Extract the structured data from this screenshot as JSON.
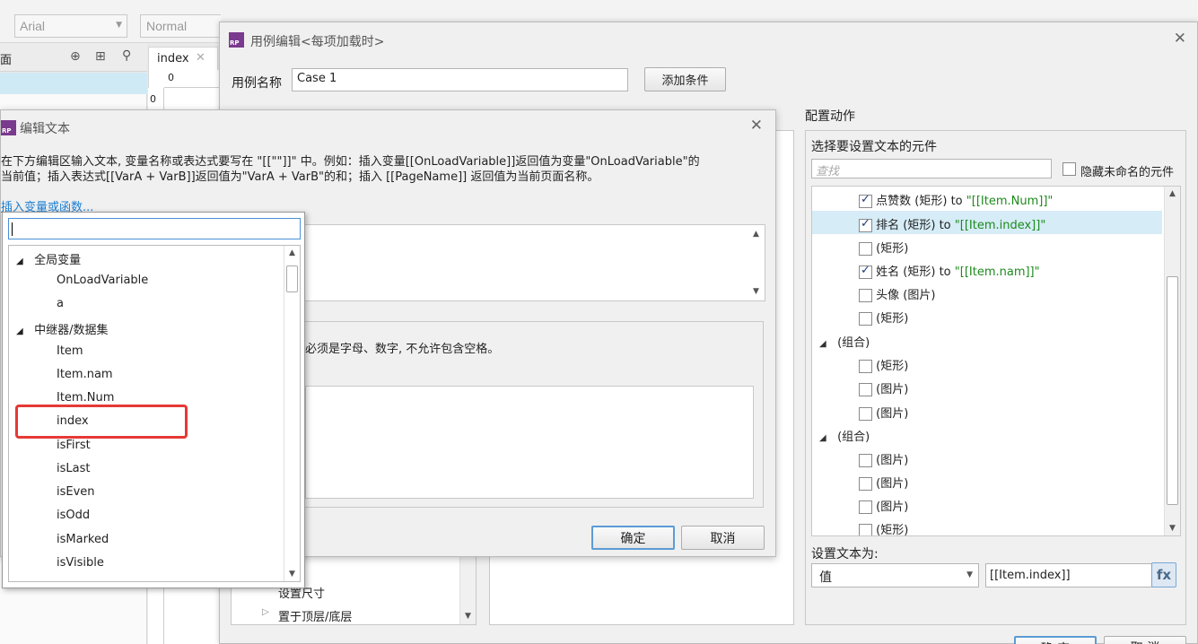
{
  "toolbar": {
    "font_value": "Arial",
    "style_value": "Normal"
  },
  "left_panel": {
    "title_partial": "面",
    "tab_label": "index",
    "ruler_zero": "0",
    "ruler_zero_v": "0"
  },
  "case_dialog": {
    "title": "用例编辑<每项加载时>",
    "case_name_label": "用例名称",
    "case_name_value": "Case 1",
    "add_condition_button": "添加条件",
    "left_items": [
      "设置尺寸",
      "置于顶层/底层"
    ]
  },
  "config": {
    "title": "配置动作",
    "select_label": "选择要设置文本的元件",
    "search_placeholder": "查找",
    "hide_unnamed_label": "隐藏未命名的元件",
    "to_word": "to",
    "items": [
      {
        "label": "点赞数 (矩形)",
        "checked": true,
        "value": "\"[[Item.Num]]\""
      },
      {
        "label": "排名 (矩形)",
        "checked": true,
        "value": "\"[[Item.index]]\""
      },
      {
        "label": "(矩形)",
        "checked": false,
        "value": ""
      },
      {
        "label": "姓名 (矩形)",
        "checked": true,
        "value": "\"[[Item.nam]]\""
      },
      {
        "label": "头像 (图片)",
        "checked": false,
        "value": ""
      },
      {
        "label": "(矩形)",
        "checked": false,
        "value": ""
      },
      {
        "label": "(组合)",
        "group": true
      },
      {
        "label": "(矩形)",
        "checked": false,
        "value": ""
      },
      {
        "label": "(图片)",
        "checked": false,
        "value": ""
      },
      {
        "label": "(图片)",
        "checked": false,
        "value": ""
      },
      {
        "label": "(组合)",
        "group": true
      },
      {
        "label": "(图片)",
        "checked": false,
        "value": ""
      },
      {
        "label": "(图片)",
        "checked": false,
        "value": ""
      },
      {
        "label": "(图片)",
        "checked": false,
        "value": ""
      },
      {
        "label": "(矩形)",
        "checked": false,
        "value": ""
      }
    ],
    "set_text_label": "设置文本为:",
    "value_type": "值",
    "value_input": "[[Item.index]]",
    "fx_label": "fx",
    "bottom_ok_partial": "确 定",
    "bottom_cancel_partial": "取 消"
  },
  "edit_text_dialog": {
    "title": "编辑文本",
    "instructions_line1": "在下方编辑区输入文本, 变量名称或表达式要写在 \"[[\"\"]]\" 中。例如：插入变量[[OnLoadVariable]]返回值为变量\"OnLoadVariable\"的",
    "instructions_line2": "当前值；插入表达式[[VarA + VarB]]返回值为\"VarA + VarB\"的和；插入 [[PageName]] 返回值为当前页面名称。",
    "insert_link": "插入变量或函数...",
    "local_var_note": "必须是字母、数字, 不允许包含空格。",
    "ok_button": "确定",
    "cancel_button": "取消"
  },
  "var_dropdown": {
    "search_value": "",
    "groups": [
      {
        "label": "全局变量",
        "items": [
          "OnLoadVariable",
          "a"
        ]
      },
      {
        "label": "中继器/数据集",
        "items": [
          "Item",
          "Item.nam",
          "Item.Num",
          "index",
          "isFirst",
          "isLast",
          "isEven",
          "isOdd",
          "isMarked",
          "isVisible"
        ]
      }
    ],
    "highlight_color": "#e53935"
  }
}
